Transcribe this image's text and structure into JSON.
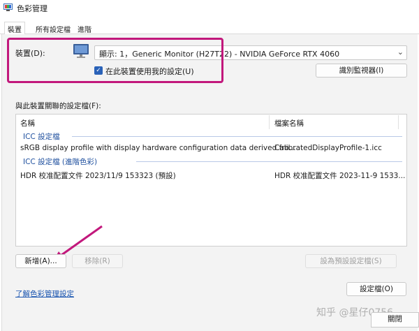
{
  "window": {
    "title": "色彩管理"
  },
  "tabs": [
    {
      "label": "裝置",
      "active": true
    },
    {
      "label": "所有設定檔",
      "active": false
    },
    {
      "label": "進階",
      "active": false
    }
  ],
  "device": {
    "label": "裝置(D):",
    "selected": "顯示: 1，Generic Monitor (H27T22) - NVIDIA GeForce RTX 4060",
    "use_settings_label": "在此裝置使用我的設定(U)",
    "use_settings_checked": true,
    "identify_button": "識別監視器(I)"
  },
  "profiles": {
    "label": "與此裝置關聯的設定檔(F):",
    "columns": [
      "名稱",
      "檔案名稱"
    ],
    "groups": [
      {
        "header": "ICC 設定檔",
        "rows": [
          {
            "name": "sRGB display profile with display hardware configuration data derived fro...",
            "file": "CalibratedDisplayProfile-1.icc"
          }
        ]
      },
      {
        "header": "ICC 設定檔 (進階色彩)",
        "rows": [
          {
            "name": "HDR 校准配置文件 2023/11/9 153323 (預設)",
            "file": "HDR 校准配置文件 2023-11-9 1533..."
          }
        ]
      }
    ]
  },
  "buttons": {
    "add": "新增(A)...",
    "remove": "移除(R)",
    "set_default": "設為預設設定檔(S)",
    "profiles": "設定檔(O)",
    "close": "關閉"
  },
  "link": {
    "learn": "了解色彩管理設定"
  },
  "watermark": "知乎 @星仔0756",
  "colors": {
    "highlight": "#c2187c",
    "accent": "#2a62b8"
  }
}
